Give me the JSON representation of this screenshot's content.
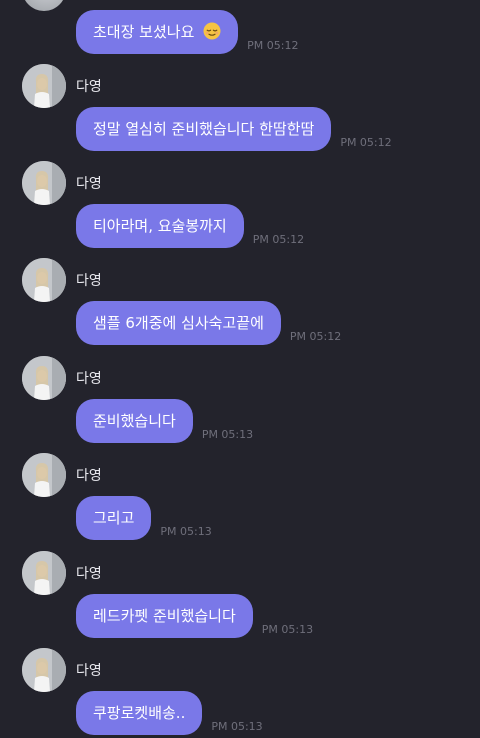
{
  "chat": {
    "messages": [
      {
        "show_sender": false,
        "sender": "",
        "text": "초대장 보셨나요",
        "emoji": "relieved-face-icon",
        "time": "PM 05:12"
      },
      {
        "show_sender": true,
        "sender": "다영",
        "text": "정말 열심히 준비했습니다 한땀한땀",
        "time": "PM 05:12"
      },
      {
        "show_sender": true,
        "sender": "다영",
        "text": "티아라며, 요술봉까지",
        "time": "PM 05:12"
      },
      {
        "show_sender": true,
        "sender": "다영",
        "text": "샘플 6개중에 심사숙고끝에",
        "time": "PM 05:12"
      },
      {
        "show_sender": true,
        "sender": "다영",
        "text": "준비했습니다",
        "time": "PM 05:13"
      },
      {
        "show_sender": true,
        "sender": "다영",
        "text": "그리고",
        "time": "PM 05:13"
      },
      {
        "show_sender": true,
        "sender": "다영",
        "text": "레드카펫 준비했습니다",
        "time": "PM 05:13"
      },
      {
        "show_sender": true,
        "sender": "다영",
        "text": "쿠팡로켓배송..",
        "time": "PM 05:13"
      }
    ]
  },
  "colors": {
    "background": "#23232c",
    "bubble": "#7a78e8",
    "bubble_text": "#ffffff",
    "time": "#6f6f7b",
    "name": "#e8e8ee"
  }
}
